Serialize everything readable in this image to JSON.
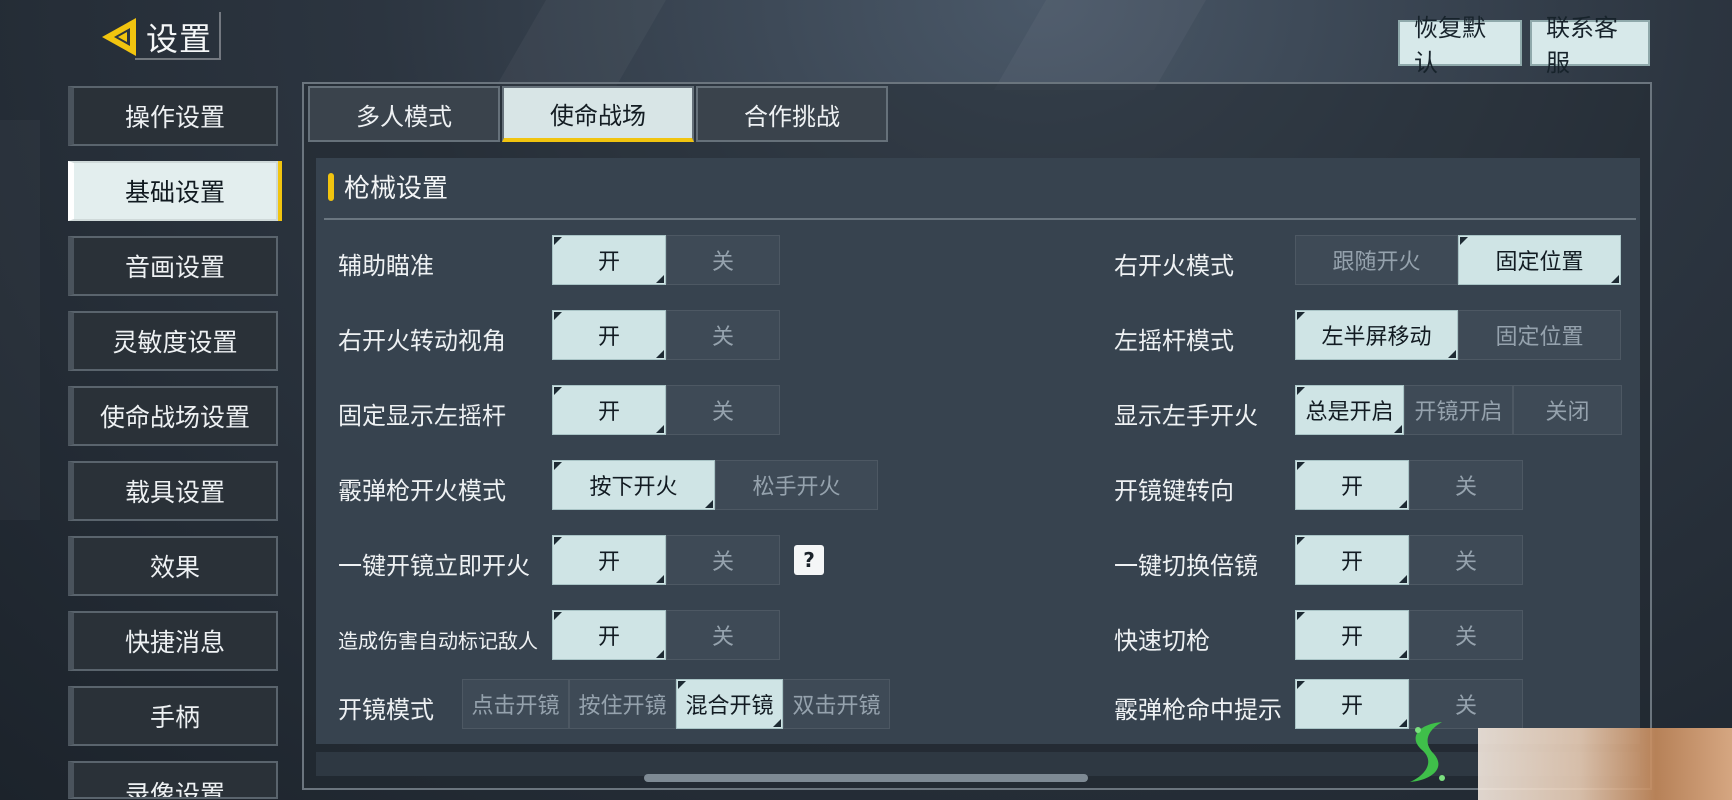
{
  "header": {
    "title": "设置",
    "restore_default": "恢复默认",
    "contact_support": "联系客服"
  },
  "sidebar": {
    "items": [
      {
        "label": "操作设置"
      },
      {
        "label": "基础设置"
      },
      {
        "label": "音画设置"
      },
      {
        "label": "灵敏度设置"
      },
      {
        "label": "使命战场设置"
      },
      {
        "label": "载具设置"
      },
      {
        "label": "效果"
      },
      {
        "label": "快捷消息"
      },
      {
        "label": "手柄"
      },
      {
        "label": "录像设置"
      }
    ],
    "active_index": 1
  },
  "tabs": [
    {
      "label": "多人模式"
    },
    {
      "label": "使命战场"
    },
    {
      "label": "合作挑战"
    }
  ],
  "section": {
    "title": "枪械设置"
  },
  "left_settings": [
    {
      "label": "辅助瞄准",
      "options": [
        "开",
        "关"
      ],
      "selected": 0
    },
    {
      "label": "右开火转动视角",
      "options": [
        "开",
        "关"
      ],
      "selected": 0
    },
    {
      "label": "固定显示左摇杆",
      "options": [
        "开",
        "关"
      ],
      "selected": 0
    },
    {
      "label": "霰弹枪开火模式",
      "options": [
        "按下开火",
        "松手开火"
      ],
      "selected": 0
    },
    {
      "label": "一键开镜立即开火",
      "options": [
        "开",
        "关"
      ],
      "selected": 0
    },
    {
      "label": "造成伤害自动标记敌人",
      "options": [
        "开",
        "关"
      ],
      "selected": 0
    },
    {
      "label": "开镜模式",
      "options": [
        "点击开镜",
        "按住开镜",
        "混合开镜",
        "双击开镜"
      ],
      "selected": 2
    }
  ],
  "right_settings": [
    {
      "label": "右开火模式",
      "options": [
        "跟随开火",
        "固定位置"
      ],
      "selected": 1
    },
    {
      "label": "左摇杆模式",
      "options": [
        "左半屏移动",
        "固定位置"
      ],
      "selected": 0
    },
    {
      "label": "显示左手开火",
      "options": [
        "总是开启",
        "开镜开启",
        "关闭"
      ],
      "selected": 0
    },
    {
      "label": "开镜键转向",
      "options": [
        "开",
        "关"
      ],
      "selected": 0
    },
    {
      "label": "一键切换倍镜",
      "options": [
        "开",
        "关"
      ],
      "selected": 0
    },
    {
      "label": "快速切枪",
      "options": [
        "开",
        "关"
      ],
      "selected": 0
    },
    {
      "label": "霰弹枪命中提示",
      "options": [
        "开",
        "关"
      ],
      "selected": 0
    }
  ],
  "help_icon": "?",
  "colors": {
    "accent": "#f1c40f",
    "selected_option": "#cfe4e5",
    "panel": "#37434f"
  }
}
